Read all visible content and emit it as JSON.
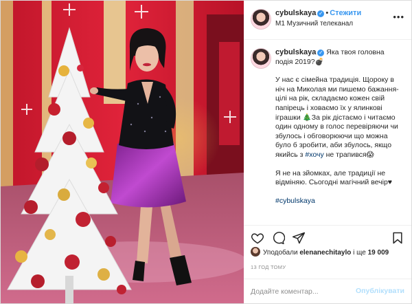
{
  "post": {
    "username": "cybulskaya",
    "follow_label": "Стежити",
    "location": "M1 Музичний телеканал",
    "more_label": "•••",
    "caption": {
      "intro": "Яка твоя головна подія 2019?",
      "para1_a": "У нас є сімейна традиція. Щороку в ніч на Миколая ми пишемо бажання-цілі на рік, складаємо кожен свій папірець і ховаємо їх у ялинкові іграшки",
      "para1_b": "За рік дістаємо і читаємо один одному в голос перевіряючи чи збулось і обговорюючи що можна було б зробити, аби збулось, якщо якийсь з",
      "para1_hashtag": "#хочу",
      "para1_c": "не трапився",
      "para2": "Я не на зйомках, але традиції не відміняю. Сьогодні магічний вечір♥",
      "hashtag": "#cybulskaya"
    },
    "likes": {
      "prefix": "Уподобали",
      "user": "elenanechitaylo",
      "middle": "і ще",
      "count": "19 009"
    },
    "time_ago": "13 ГОД ТОМУ",
    "comment": {
      "placeholder": "Додайте коментар...",
      "post_label": "Опублікувати"
    },
    "icons": [
      "heart-icon",
      "comment-icon",
      "share-icon",
      "bookmark-icon",
      "verified-icon"
    ],
    "colors": {
      "link": "#3897f0",
      "hashtag": "#00376b",
      "border": "#dbdbdb",
      "muted": "#8e8e8e"
    }
  }
}
